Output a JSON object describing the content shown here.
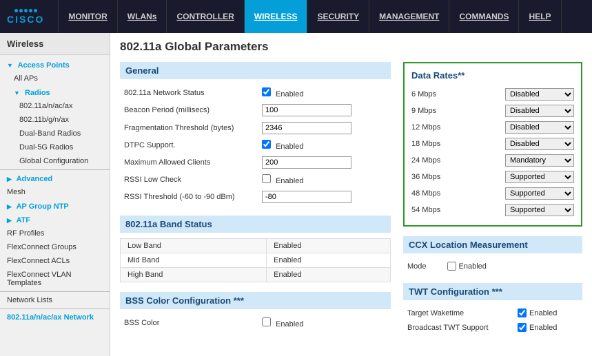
{
  "header": {
    "logo_dots": 5,
    "logo_text": "CISCO",
    "nav_items": [
      {
        "label": "MONITOR",
        "active": false
      },
      {
        "label": "WLANs",
        "active": false
      },
      {
        "label": "CONTROLLER",
        "active": false
      },
      {
        "label": "WIRELESS",
        "active": true
      },
      {
        "label": "SECURITY",
        "active": false
      },
      {
        "label": "MANAGEMENT",
        "active": false
      },
      {
        "label": "COMMANDS",
        "active": false
      },
      {
        "label": "HELP",
        "active": false
      }
    ]
  },
  "sidebar": {
    "title": "Wireless",
    "items": [
      {
        "label": "Access Points",
        "type": "group-open",
        "active": true
      },
      {
        "label": "All APs",
        "type": "indent1"
      },
      {
        "label": "Radios",
        "type": "indent1-group"
      },
      {
        "label": "802.11a/n/ac/ax",
        "type": "indent2"
      },
      {
        "label": "802.11b/g/n/ax",
        "type": "indent2"
      },
      {
        "label": "Dual-Band Radios",
        "type": "indent2"
      },
      {
        "label": "Dual-5G Radios",
        "type": "indent2"
      },
      {
        "label": "Global Configuration",
        "type": "indent2"
      },
      {
        "label": "Advanced",
        "type": "group"
      },
      {
        "label": "Mesh",
        "type": "plain"
      },
      {
        "label": "AP Group NTP",
        "type": "group"
      },
      {
        "label": "ATF",
        "type": "group"
      },
      {
        "label": "RF Profiles",
        "type": "plain"
      },
      {
        "label": "FlexConnect Groups",
        "type": "plain"
      },
      {
        "label": "FlexConnect ACLs",
        "type": "plain"
      },
      {
        "label": "FlexConnect VLAN Templates",
        "type": "plain"
      },
      {
        "label": "Network Lists",
        "type": "plain"
      },
      {
        "label": "802.11a/n/ac/ax Network",
        "type": "active"
      }
    ]
  },
  "page": {
    "title": "802.11a Global Parameters",
    "general": {
      "header": "General",
      "fields": [
        {
          "label": "802.11a Network Status",
          "type": "checkbox",
          "checked": true,
          "value": "Enabled"
        },
        {
          "label": "Beacon Period (millisecs)",
          "type": "text",
          "value": "100"
        },
        {
          "label": "Fragmentation Threshold (bytes)",
          "type": "text",
          "value": "2346"
        },
        {
          "label": "DTPC Support.",
          "type": "checkbox",
          "checked": true,
          "value": "Enabled"
        },
        {
          "label": "Maximum Allowed Clients",
          "type": "text",
          "value": "200"
        },
        {
          "label": "RSSI Low Check",
          "type": "checkbox",
          "checked": false,
          "value": "Enabled"
        },
        {
          "label": "RSSI Threshold (-60 to -90 dBm)",
          "type": "text",
          "value": "-80"
        }
      ]
    },
    "band_status": {
      "header": "802.11a Band Status",
      "rows": [
        {
          "band": "Low Band",
          "status": "Enabled"
        },
        {
          "band": "Mid Band",
          "status": "Enabled"
        },
        {
          "band": "High Band",
          "status": "Enabled"
        }
      ]
    },
    "bss_color": {
      "header": "BSS Color Configuration ***",
      "field_label": "BSS Color",
      "type": "checkbox",
      "checked": false,
      "value": "Enabled"
    },
    "data_rates": {
      "header": "Data Rates**",
      "rates": [
        {
          "label": "6 Mbps",
          "value": "Disabled"
        },
        {
          "label": "9 Mbps",
          "value": "Disabled"
        },
        {
          "label": "12 Mbps",
          "value": "Disabled"
        },
        {
          "label": "18 Mbps",
          "value": "Disabled"
        },
        {
          "label": "24 Mbps",
          "value": "Mandatory"
        },
        {
          "label": "36 Mbps",
          "value": "Supported"
        },
        {
          "label": "48 Mbps",
          "value": "Supported"
        },
        {
          "label": "54 Mbps",
          "value": "Supported"
        }
      ],
      "options": [
        "Disabled",
        "Mandatory",
        "Supported"
      ]
    },
    "ccx": {
      "header": "CCX Location Measurement",
      "mode_label": "Mode",
      "checked": false,
      "value": "Enabled"
    },
    "twt": {
      "header": "TWT Configuration ***",
      "rows": [
        {
          "label": "Target Waketime",
          "checked": true,
          "value": "Enabled"
        },
        {
          "label": "Broadcast TWT Support",
          "checked": true,
          "value": "Enabled"
        }
      ]
    }
  }
}
